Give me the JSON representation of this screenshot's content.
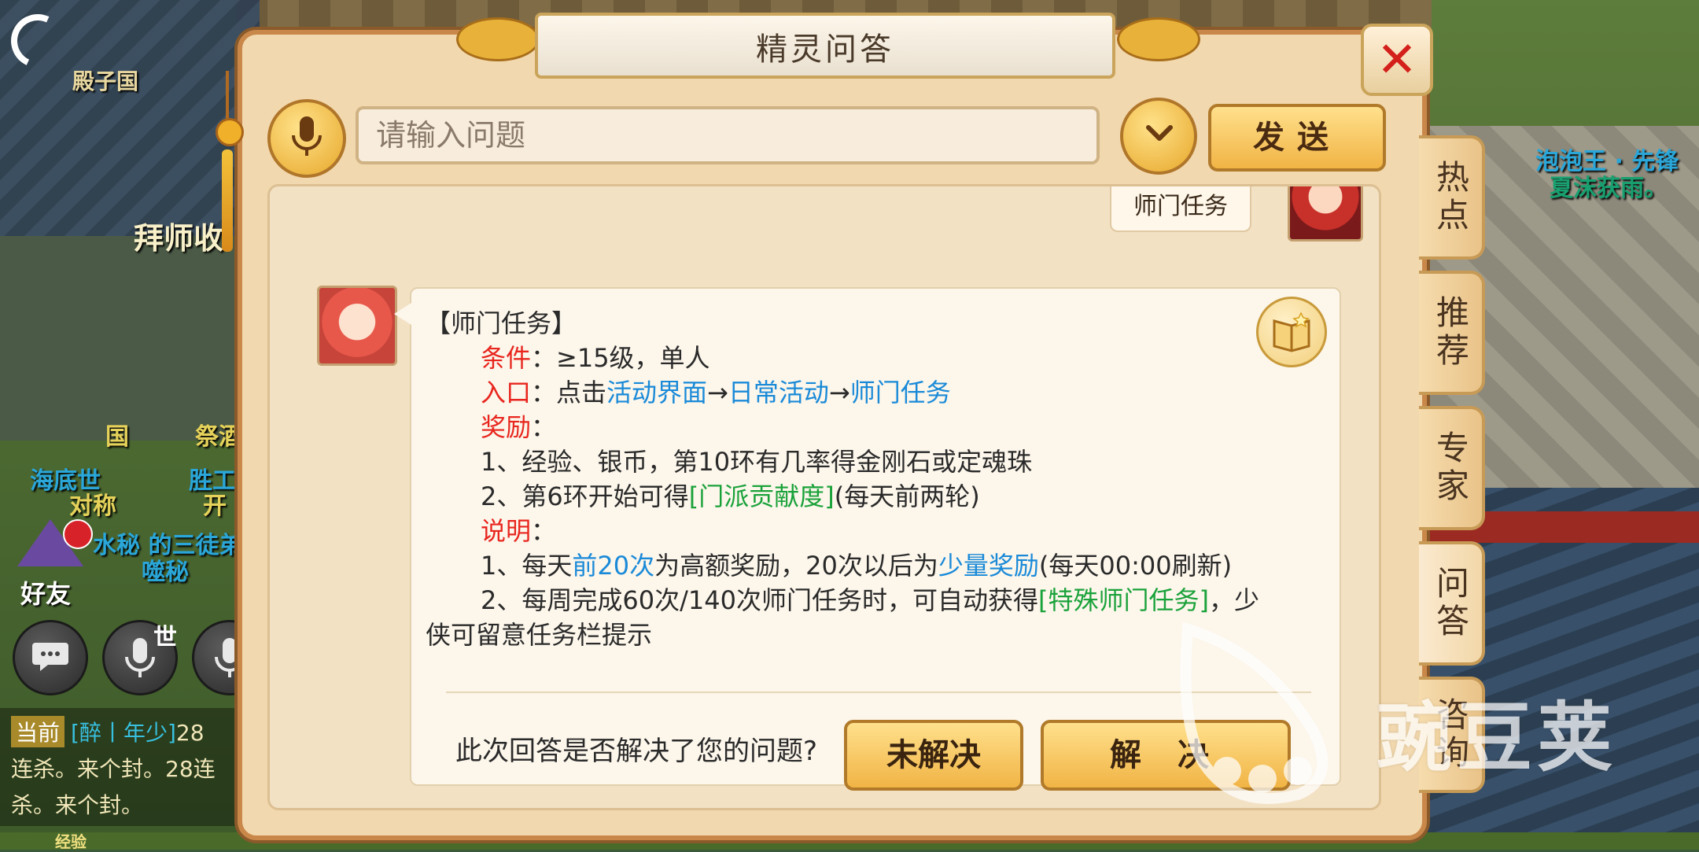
{
  "scene": {
    "npc_left_title": "拜师收",
    "npc_left_sign": "殿子国",
    "npc_left_name_1": "国",
    "npc_left_name_2": "祭酒",
    "npc_left_name_3": "海底世",
    "npc_left_name_4": "胜工",
    "npc_left_name_5": "对称",
    "npc_left_name_6": "开",
    "npc_left_name_7": "水秘 的三徒弟",
    "npc_left_name_8": "噬秘",
    "npc_right_name_1": "泡泡王 · 先锋",
    "npc_right_name_2": "夏沫获雨。",
    "friend_label": "好友",
    "world_label": "世"
  },
  "chat": {
    "tag": "当前",
    "name": "[醉丨年少]",
    "line_1_suffix": "28",
    "line_2": "连杀。来个封。28连",
    "line_3": "杀。来个封。",
    "exp_label": "经验"
  },
  "dialog": {
    "title": "精灵问答",
    "close_label": "✕",
    "search_placeholder": "请输入问题",
    "send_label": "发送",
    "user_question": "师门任务",
    "answer": {
      "heading": "【师门任务】",
      "cond_label": "条件",
      "cond_text": "：≥15级，单人",
      "entry_label": "入口",
      "entry_prefix": "：点击",
      "entry_link_1": "活动界面",
      "arrow": "→",
      "entry_link_2": "日常活动",
      "entry_link_3": "师门任务",
      "reward_label": "奖励",
      "colon": "：",
      "reward_1": "1、经验、银币，第10环有几率得金刚石或定魂珠",
      "reward_2_prefix": "2、第6环开始可得",
      "reward_2_link": "[门派贡献度]",
      "reward_2_suffix": "(每天前两轮)",
      "note_label": "说明",
      "note_1_prefix": "1、每天",
      "note_1_link_1": "前20次",
      "note_1_mid": "为高额奖励，20次以后为",
      "note_1_link_2": "少量奖励",
      "note_1_suffix": "(每天00:00刷新)",
      "note_2_prefix": "2、每周完成60次/140次师门任务时，可自动获得",
      "note_2_link": "[特殊师门任务]",
      "note_2_suffix": "，少",
      "note_2_line2": "侠可留意任务栏提示"
    },
    "feedback_question": "此次回答是否解决了您的问题?",
    "unresolved_label": "未解决",
    "resolved_label": "解 决"
  },
  "side_tabs": [
    "热点",
    "推荐",
    "专家",
    "问答",
    "咨询"
  ],
  "watermark": "豌豆荚"
}
